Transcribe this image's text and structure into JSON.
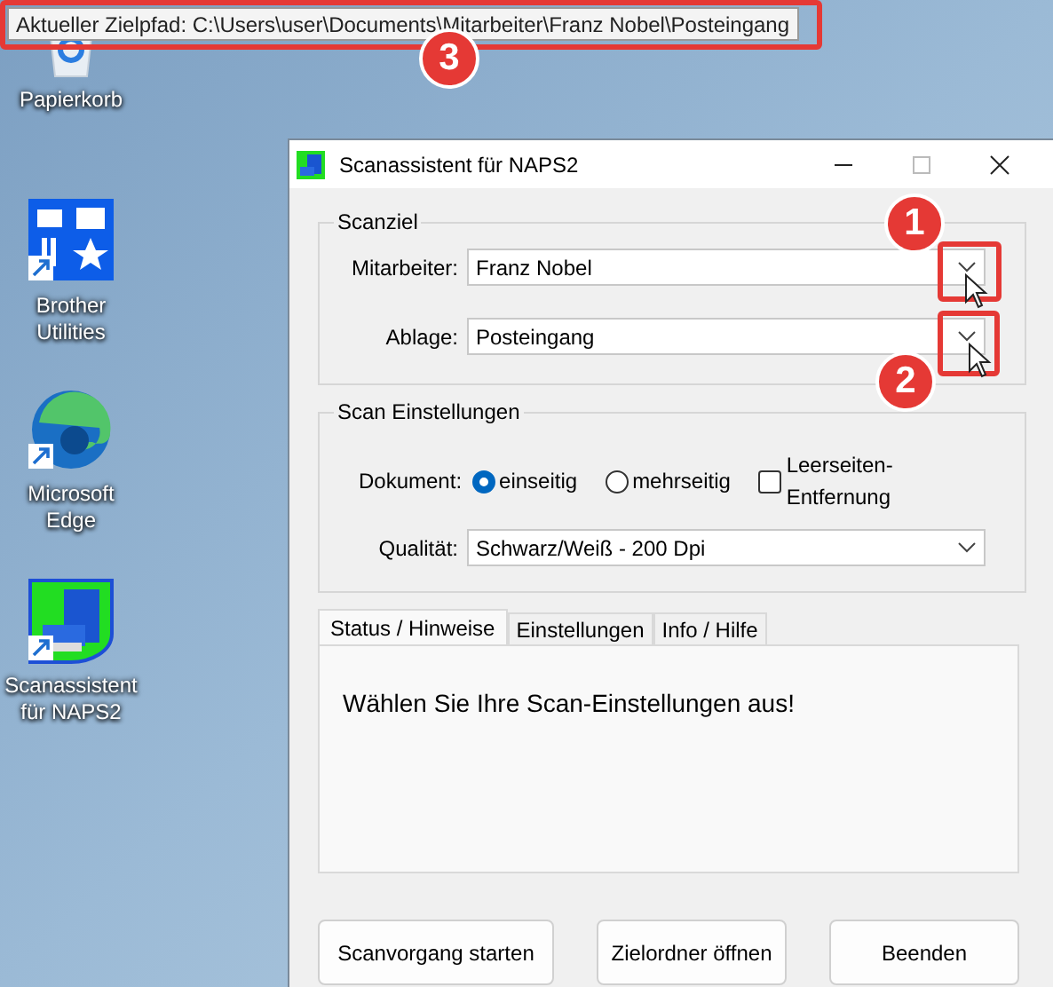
{
  "tooltip": {
    "text": "Aktueller Zielpfad: C:\\Users\\user\\Documents\\Mitarbeiter\\Franz Nobel\\Posteingang"
  },
  "desktop_icons": [
    {
      "label": "Papierkorb",
      "kind": "recycle"
    },
    {
      "label": "Brother Utilities",
      "kind": "brother"
    },
    {
      "label": "Microsoft Edge",
      "kind": "edge"
    },
    {
      "label": "Scanassistent für NAPS2",
      "kind": "naps"
    }
  ],
  "window": {
    "title": "Scanassistent für NAPS2"
  },
  "scan_target": {
    "title": "Scanziel",
    "fields": [
      {
        "label": "Mitarbeiter:",
        "value": "Franz Nobel"
      },
      {
        "label": "Ablage:",
        "value": "Posteingang"
      }
    ]
  },
  "scan_settings": {
    "title": "Scan Einstellungen",
    "document_label": "Dokument:",
    "options": [
      {
        "label": "einseitig",
        "selected": true
      },
      {
        "label": "mehrseitig",
        "selected": false
      }
    ],
    "blank_removal": {
      "label": "Leerseiten-Entfernung",
      "checked": false
    },
    "quality_label": "Qualität:",
    "quality": "Schwarz/Weiß - 200 Dpi"
  },
  "tabs": [
    {
      "label": "Status / Hinweise",
      "selected": true
    },
    {
      "label": "Einstellungen",
      "selected": false
    },
    {
      "label": "Info / Hilfe",
      "selected": false
    }
  ],
  "status_message": "Wählen Sie Ihre Scan-Einstellungen aus!",
  "buttons": [
    "Scanvorgang starten",
    "Zielordner öffnen",
    "Beenden"
  ],
  "annotations": [
    "1",
    "2",
    "3"
  ]
}
